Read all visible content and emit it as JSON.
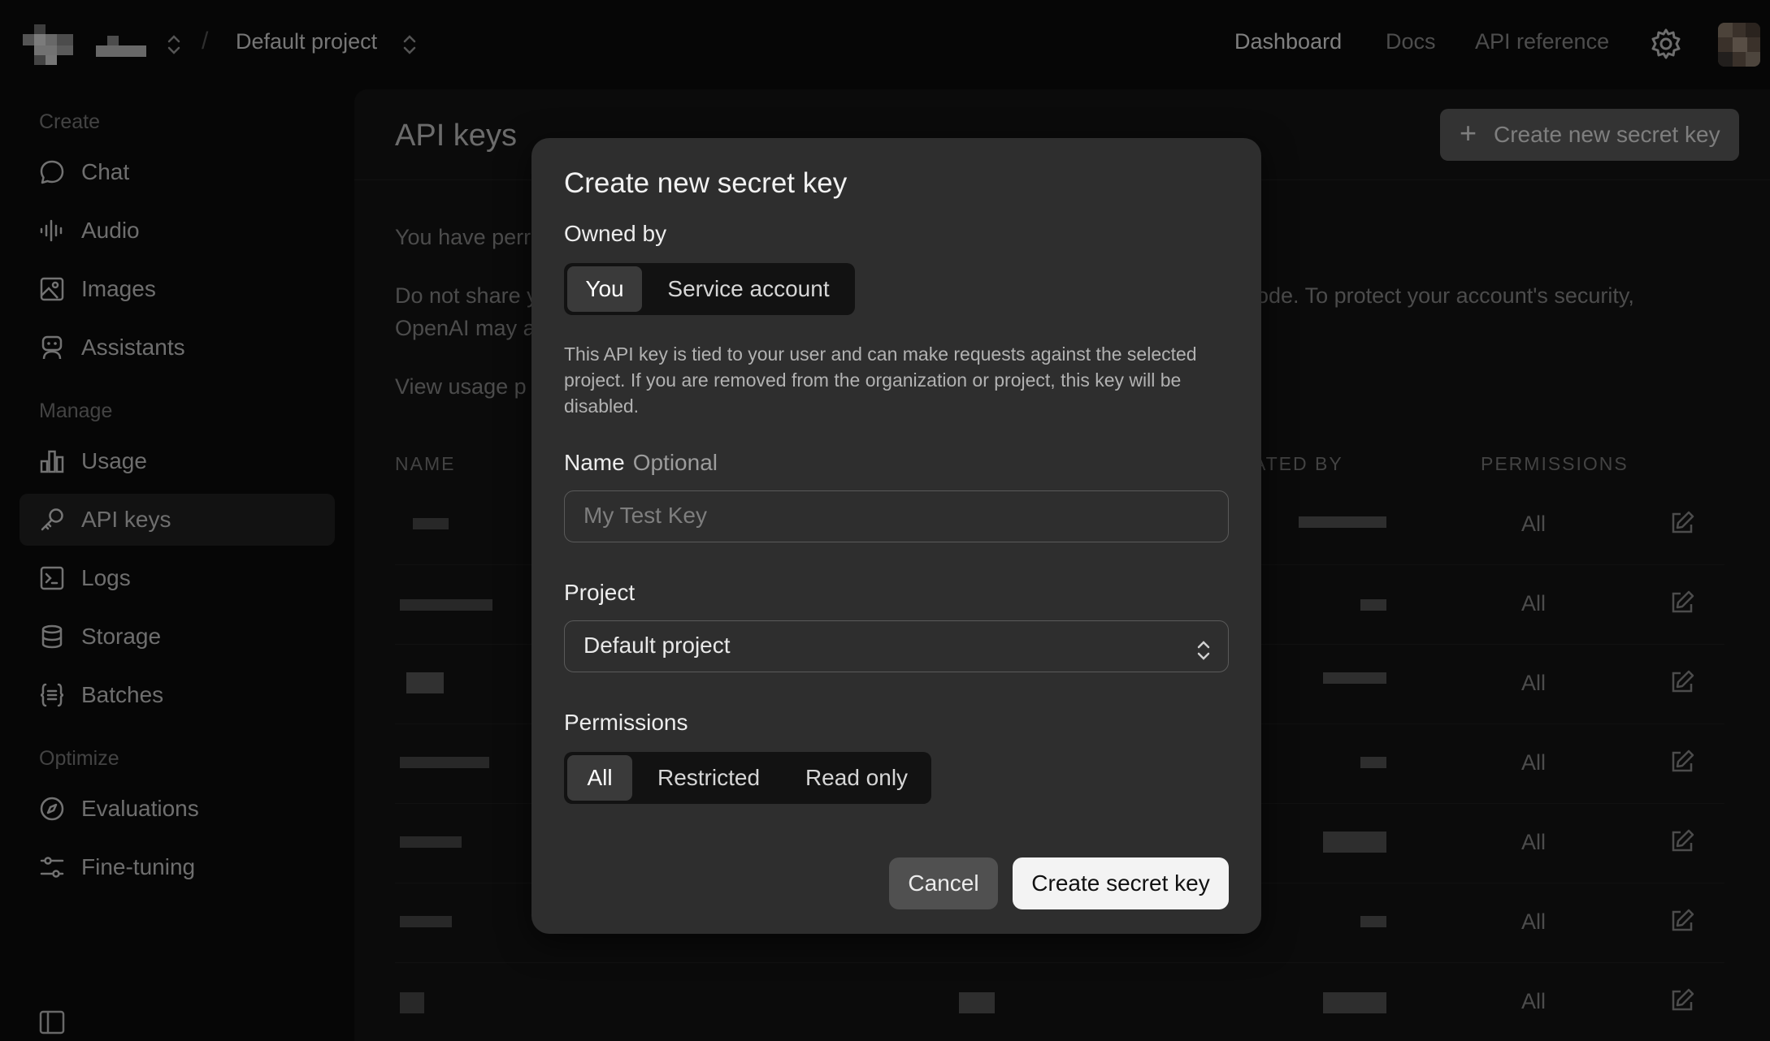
{
  "topbar": {
    "project_name": "Default project",
    "nav": [
      "Dashboard",
      "Docs",
      "API reference"
    ]
  },
  "sidebar": {
    "sections": [
      {
        "label": "Create",
        "items": [
          "Chat",
          "Audio",
          "Images",
          "Assistants"
        ]
      },
      {
        "label": "Manage",
        "items": [
          "Usage",
          "API keys",
          "Logs",
          "Storage",
          "Batches"
        ]
      },
      {
        "label": "Optimize",
        "items": [
          "Evaluations",
          "Fine-tuning"
        ]
      }
    ],
    "active_item": "API keys"
  },
  "main": {
    "title": "API keys",
    "create_button_label": "Create new secret key",
    "text_1": "You have perr",
    "text_2a": "Do not share y",
    "text_2b": "OpenAI may a",
    "text_2_right": "ode. To protect your account's security,",
    "text_3": "View usage p",
    "columns": {
      "name": "NAME",
      "created_by": "ATED BY",
      "permissions": "PERMISSIONS"
    },
    "rows": [
      {
        "permission": "All"
      },
      {
        "permission": "All"
      },
      {
        "permission": "All"
      },
      {
        "permission": "All"
      },
      {
        "permission": "All"
      },
      {
        "permission": "All"
      },
      {
        "permission": "All"
      }
    ]
  },
  "modal": {
    "title": "Create new secret key",
    "owned_by_label": "Owned by",
    "owned_by_options": [
      "You",
      "Service account"
    ],
    "owned_by_selected": "You",
    "description": "This API key is tied to your user and can make requests against the selected project. If you are removed from the organization or project, this key will be disabled.",
    "name_label": "Name",
    "name_optional": "Optional",
    "name_placeholder": "My Test Key",
    "project_label": "Project",
    "project_value": "Default project",
    "permissions_label": "Permissions",
    "permissions_options": [
      "All",
      "Restricted",
      "Read only"
    ],
    "permissions_selected": "All",
    "cancel_label": "Cancel",
    "create_label": "Create secret key"
  }
}
